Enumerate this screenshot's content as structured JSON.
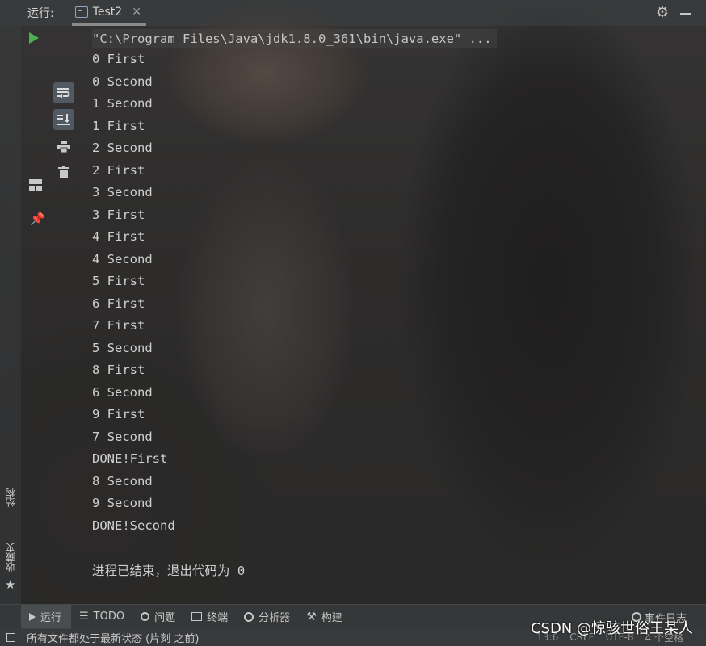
{
  "header": {
    "run_title": "运行:",
    "tab_label": "Test2",
    "tab_close": "✕"
  },
  "left_strip": {
    "structure_label": "结构",
    "bookmarks_label": "收藏夹"
  },
  "console": {
    "command": "\"C:\\Program Files\\Java\\jdk1.8.0_361\\bin\\java.exe\" ...",
    "lines": [
      "0 First",
      "0 Second",
      "1 Second",
      "1 First",
      "2 Second",
      "2 First",
      "3 Second",
      "3 First",
      "4 First",
      "4 Second",
      "5 First",
      "6 First",
      "7 First",
      "5 Second",
      "8 First",
      "6 Second",
      "9 First",
      "7 Second",
      "DONE!First",
      "8 Second",
      "9 Second",
      "DONE!Second"
    ],
    "exit_message": "进程已结束，退出代码为 0"
  },
  "bottom_tabs": {
    "run": "运行",
    "todo": "TODO",
    "problems": "问题",
    "terminal": "终端",
    "analyzer": "分析器",
    "build": "构建",
    "event_log": "事件日志"
  },
  "status_bar": {
    "message": "所有文件都处于最新状态 (片刻 之前)",
    "position": "13:6",
    "line_sep": "CRLF",
    "encoding": "UTF-8",
    "indent": "4 个空格"
  },
  "watermark": "CSDN @惊骇世俗王某人",
  "icons": {
    "run": "play-icon",
    "settings": "gear-icon"
  },
  "colors": {
    "run_green": "#4caf50",
    "active_tool_bg": "#6f8296"
  }
}
